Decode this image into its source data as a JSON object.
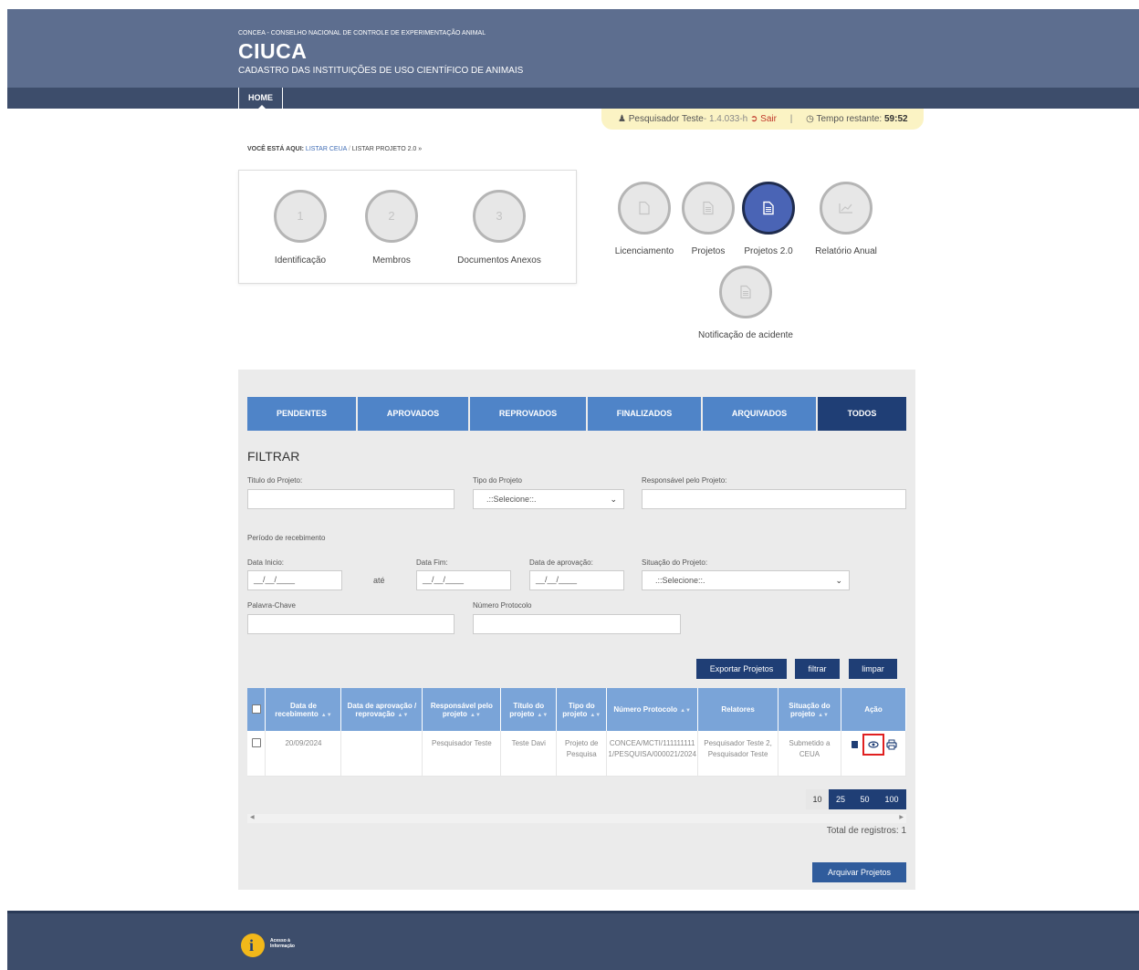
{
  "header": {
    "org": "CONCEA - CONSELHO NACIONAL DE CONTROLE DE EXPERIMENTAÇÃO ANIMAL",
    "brand": "CIUCA",
    "subtitle": "CADASTRO DAS INSTITUIÇÕES DE USO CIENTÍFICO DE ANIMAIS"
  },
  "nav": {
    "home": "HOME"
  },
  "userbar": {
    "user": "Pesquisador Teste",
    "version": "- 1.4.033-h",
    "logout": "Sair",
    "separator": "|",
    "time_label": "Tempo restante:",
    "time_value": "59:52"
  },
  "breadcrumb": {
    "prefix": "VOCÊ ESTÁ AQUI:",
    "item1": "LISTAR CEUA",
    "sep": "/",
    "item2": "LISTAR PROJETO 2.0 »"
  },
  "steps": [
    {
      "num": "1",
      "label": "Identificação"
    },
    {
      "num": "2",
      "label": "Membros"
    },
    {
      "num": "3",
      "label": "Documentos Anexos"
    }
  ],
  "modules": [
    {
      "label": "Licenciamento"
    },
    {
      "label": "Projetos"
    },
    {
      "label": "Projetos 2.0"
    },
    {
      "label": "Relatório Anual"
    },
    {
      "label": "Notificação de acidente"
    }
  ],
  "tabs": [
    "PENDENTES",
    "APROVADOS",
    "REPROVADOS",
    "FINALIZADOS",
    "ARQUIVADOS",
    "TODOS"
  ],
  "filter": {
    "title": "FILTRAR",
    "titulo_label": "Titulo do Projeto:",
    "tipo_label": "Tipo do Projeto",
    "tipo_value": ".::Selecione::.",
    "responsavel_label": "Responsável pelo Projeto:",
    "periodo_label": "Período de recebimento",
    "data_inicio_label": "Data Inicio:",
    "data_inicio_value": "__/__/____",
    "ate": "até",
    "data_fim_label": "Data Fim:",
    "data_fim_value": "__/__/____",
    "data_aprov_label": "Data de aprovação:",
    "data_aprov_value": "__/__/____",
    "situacao_label": "Situação do Projeto:",
    "situacao_value": ".::Selecione::.",
    "palavra_label": "Palavra-Chave",
    "protocolo_label": "Número Protocolo"
  },
  "buttons": {
    "exportar": "Exportar Projetos",
    "filtrar": "filtrar",
    "limpar": "limpar",
    "arquivar": "Arquivar Projetos"
  },
  "table": {
    "headers": [
      "Data de recebimento",
      "Data de aprovação / reprovação",
      "Responsável pelo projeto",
      "Título do projeto",
      "Tipo do projeto",
      "Número Protocolo",
      "Relatores",
      "Situação do projeto",
      "Ação"
    ],
    "rows": [
      [
        "20/09/2024",
        "",
        "Pesquisador Teste",
        "Teste Davi",
        "Projeto de Pesquisa",
        "CONCEA/MCTI/1111111111/PESQUISA/000021/2024",
        "Pesquisador Teste 2, Pesquisador Teste",
        "Submetido a CEUA"
      ]
    ]
  },
  "pagination": {
    "sizes": [
      "10",
      "25",
      "50",
      "100"
    ]
  },
  "total": "Total de registros: 1",
  "footer": {
    "logo_letter": "i",
    "logo_text": "Acesso à Informação"
  }
}
